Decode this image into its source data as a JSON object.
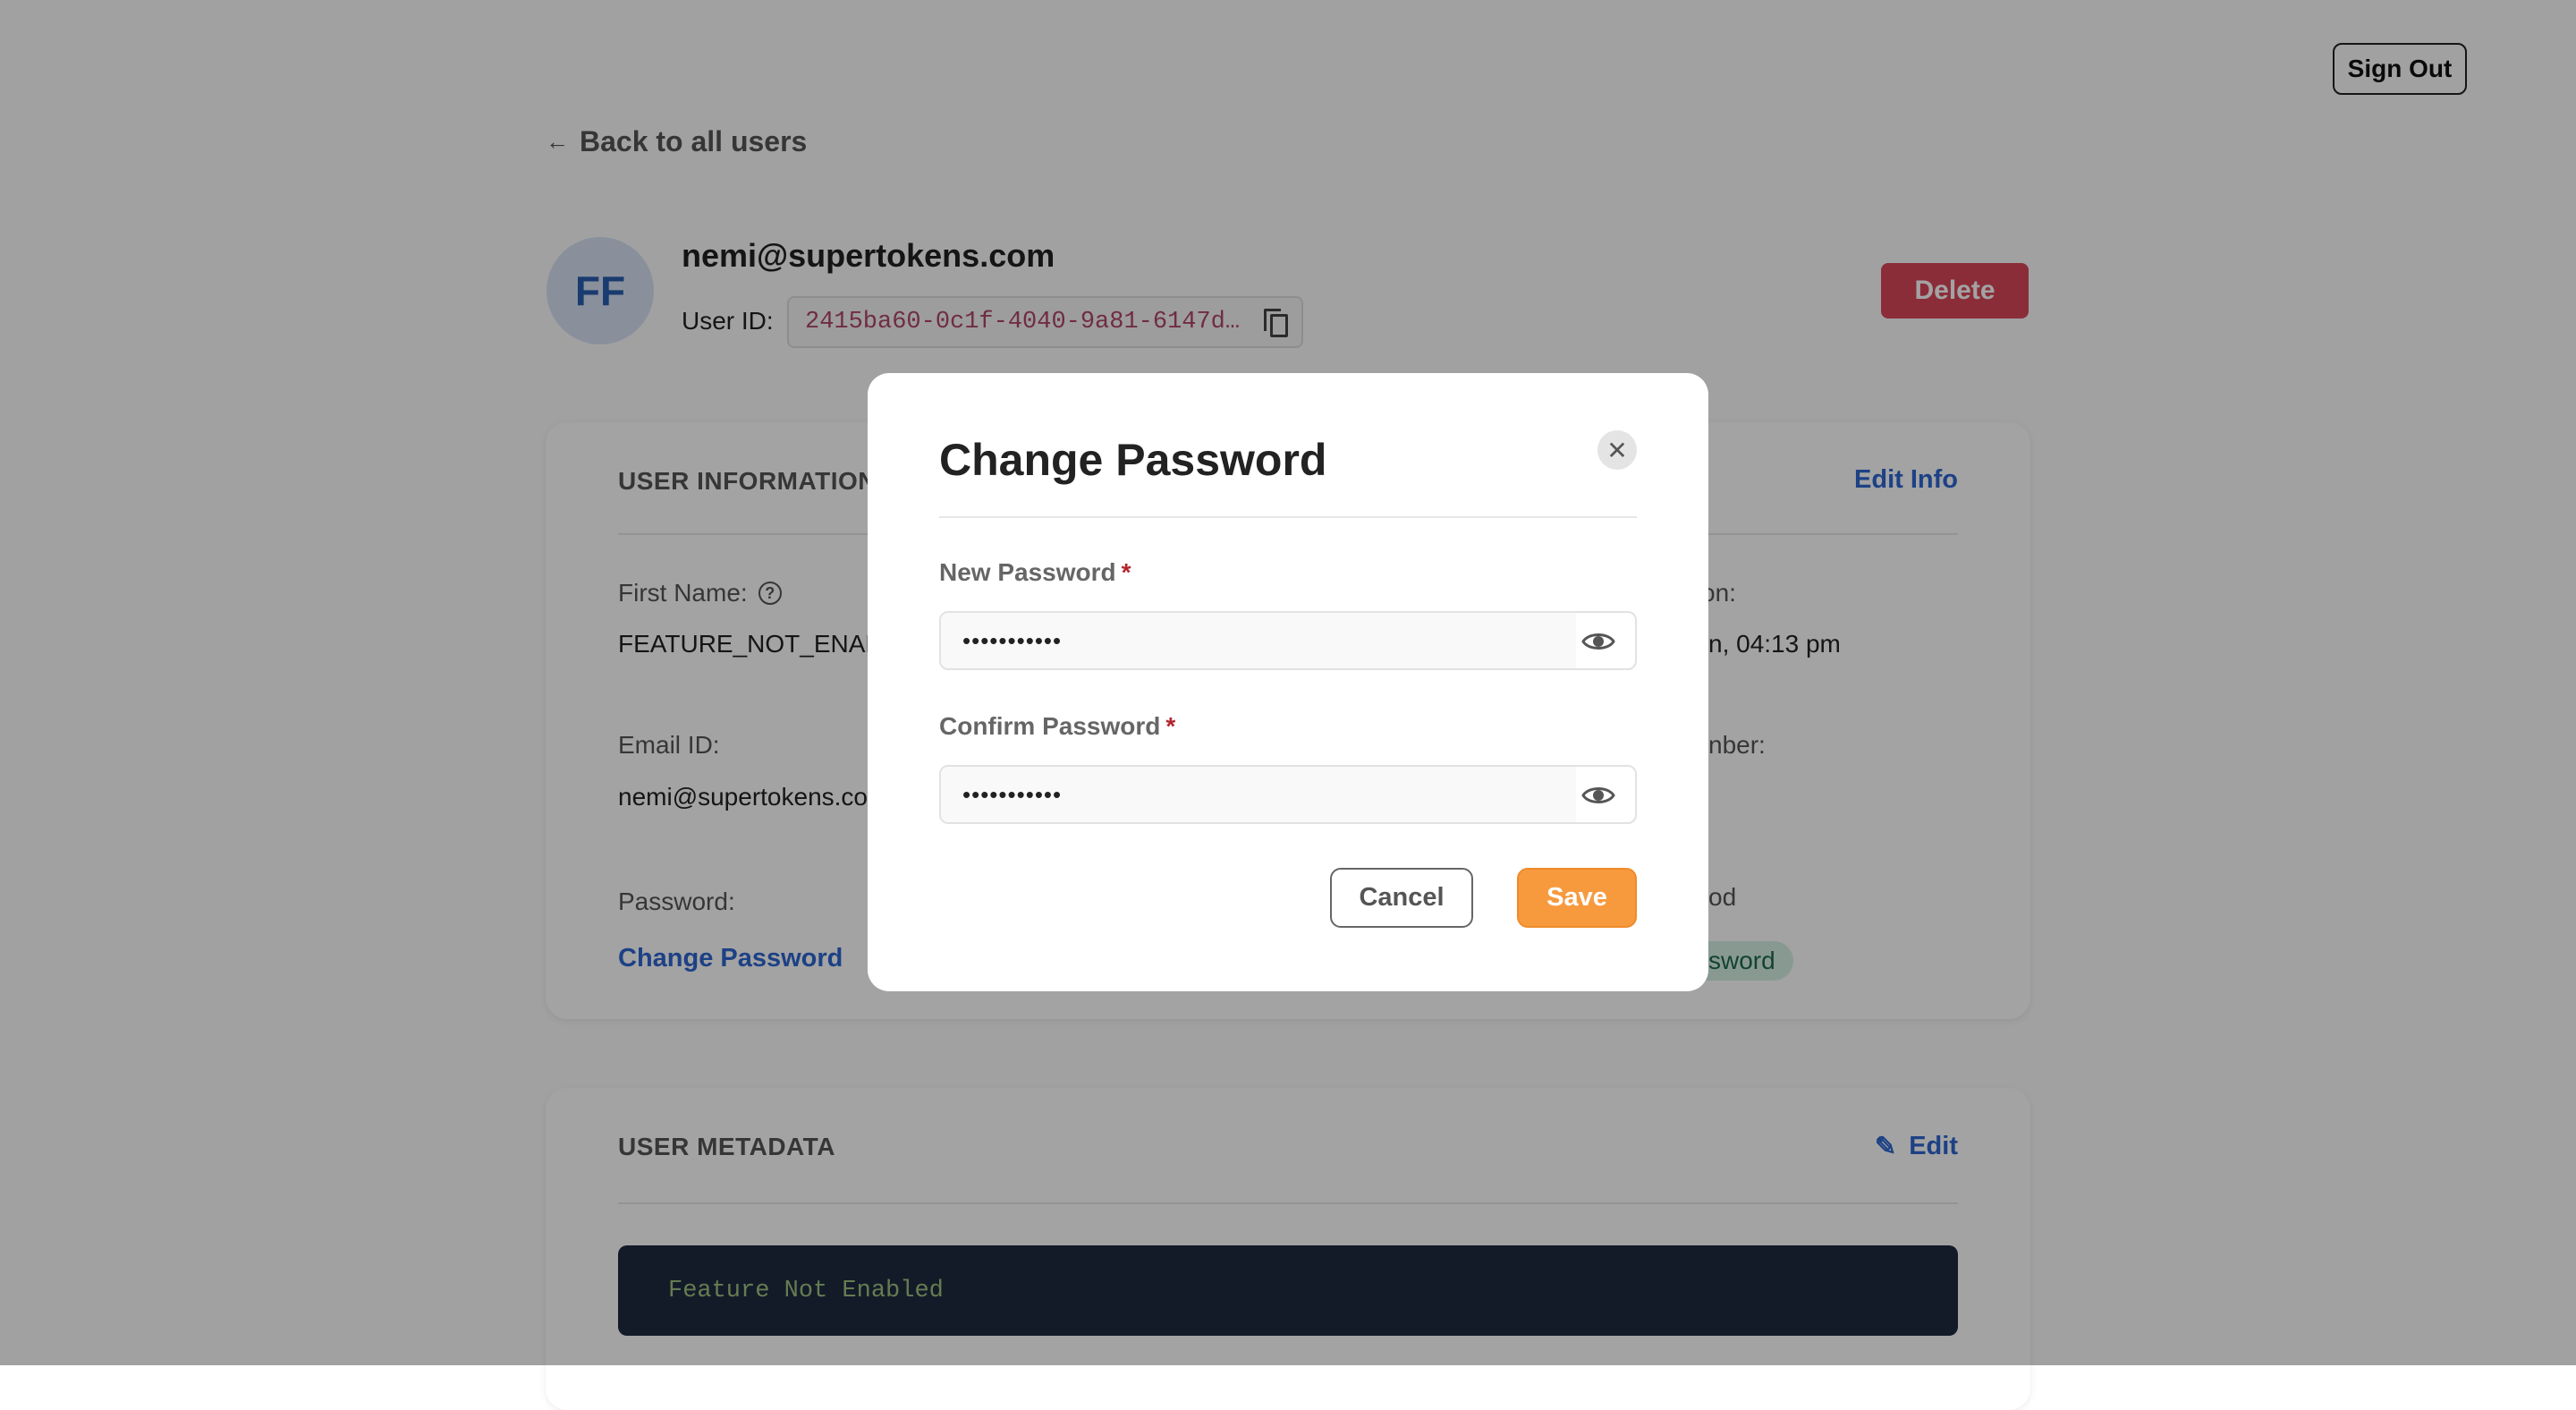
{
  "header": {
    "sign_out_label": "Sign Out",
    "back_label": "Back to all users"
  },
  "user": {
    "initials": "FF",
    "email": "nemi@supertokens.com",
    "user_id_label": "User ID:",
    "user_id": "2415ba60-0c1f-4040-9a81-6147d…",
    "delete_label": "Delete"
  },
  "user_information": {
    "title": "USER INFORMATION",
    "edit_label": "Edit Info",
    "fields": {
      "first_name_label": "First Name:",
      "first_name_value": "FEATURE_NOT_ENABLED",
      "email_label": "Email ID:",
      "email_value": "nemi@supertokens.com",
      "password_label": "Password:",
      "change_password_label": "Change Password",
      "created_label_partial": "on:",
      "created_value_partial": "n, 04:13 pm",
      "phone_label_partial": "nber:",
      "method_label_partial": "od",
      "method_badge_partial": "sword"
    }
  },
  "user_metadata": {
    "title": "USER METADATA",
    "edit_label": "Edit",
    "content": "Feature Not Enabled"
  },
  "modal": {
    "title": "Change Password",
    "new_password_label": "New Password",
    "new_password_value": "•••••••••••",
    "confirm_password_label": "Confirm Password",
    "confirm_password_value": "•••••••••••",
    "required_mark": "*",
    "cancel_label": "Cancel",
    "save_label": "Save"
  },
  "colors": {
    "accent_link": "#2e67d1",
    "save_button": "#f79a3e",
    "delete_button": "#d9475a",
    "user_id_text": "#b0456a",
    "code_bg": "#1e2b40"
  }
}
